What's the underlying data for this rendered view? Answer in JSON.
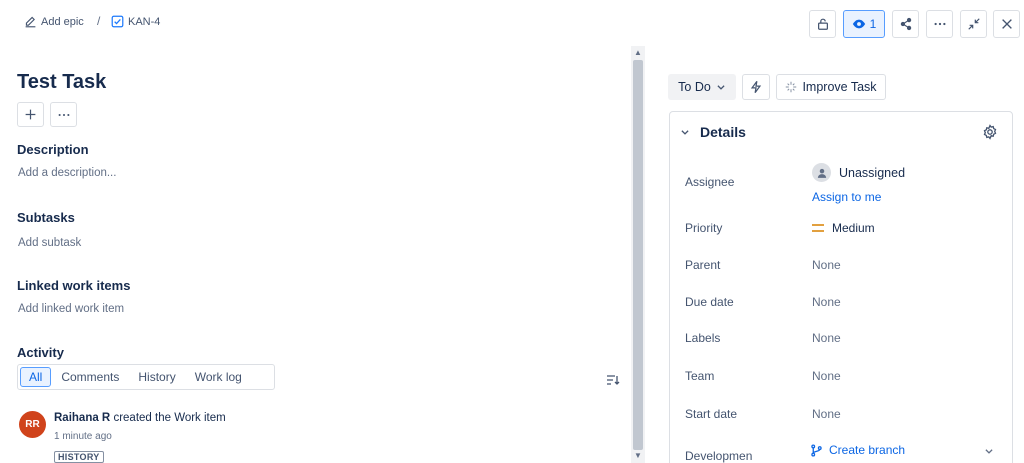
{
  "breadcrumb": {
    "epic_label": "Add epic",
    "separator": "/",
    "issue_key": "KAN-4"
  },
  "toolbar": {
    "watch_count": "1"
  },
  "issue": {
    "title": "Test Task"
  },
  "description": {
    "heading": "Description",
    "placeholder": "Add a description..."
  },
  "subtasks": {
    "heading": "Subtasks",
    "placeholder": "Add subtask"
  },
  "linked": {
    "heading": "Linked work items",
    "placeholder": "Add linked work item"
  },
  "activity": {
    "heading": "Activity",
    "tabs": [
      "All",
      "Comments",
      "History",
      "Work log"
    ],
    "active_tab": "All",
    "entry": {
      "avatar_initials": "RR",
      "author": "Raihana R",
      "action": "created the Work item",
      "time": "1 minute ago",
      "badge": "HISTORY"
    }
  },
  "status": {
    "label": "To Do"
  },
  "improve": {
    "label": "Improve Task"
  },
  "details": {
    "heading": "Details",
    "assignee_label": "Assignee",
    "assignee_value": "Unassigned",
    "assign_link": "Assign to me",
    "priority_label": "Priority",
    "priority_value": "Medium",
    "parent_label": "Parent",
    "parent_value": "None",
    "due_label": "Due date",
    "due_value": "None",
    "labels_label": "Labels",
    "labels_value": "None",
    "team_label": "Team",
    "team_value": "None",
    "start_label": "Start date",
    "start_value": "None",
    "development_label": "Developmen",
    "development_value": "Create branch"
  },
  "colors": {
    "link_blue": "#0c66e4",
    "selected_bg": "#e9f2ff",
    "priority_medium": "#e2a03f",
    "avatar_bg": "#d0431b"
  }
}
